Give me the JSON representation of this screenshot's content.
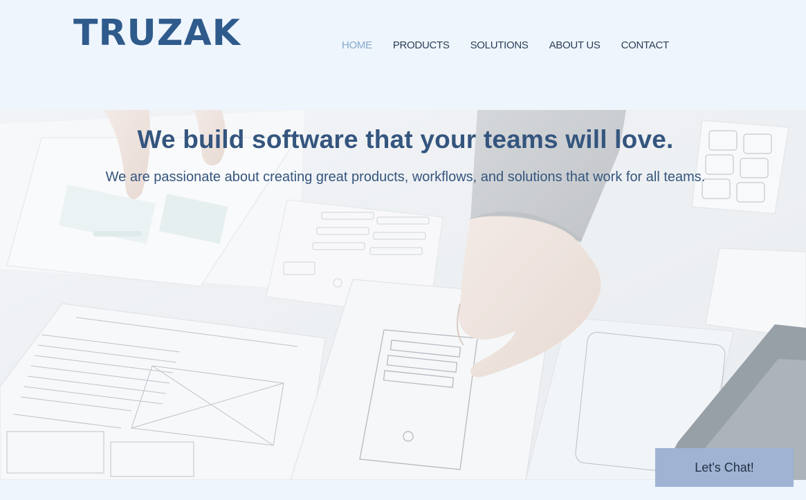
{
  "brand": {
    "logo_text": "TRUZAK"
  },
  "nav": {
    "items": [
      {
        "label": "HOME",
        "active": true
      },
      {
        "label": "PRODUCTS",
        "active": false
      },
      {
        "label": "SOLUTIONS",
        "active": false
      },
      {
        "label": "ABOUT US",
        "active": false
      },
      {
        "label": "CONTACT",
        "active": false
      }
    ]
  },
  "hero": {
    "title": "We build software that your teams will love.",
    "subtitle": "We are passionate about creating great products, workflows, and solutions that work for all teams.",
    "image_subject": "hands-arranging-wireframe-sketches"
  },
  "chat": {
    "label": "Let's Chat!"
  },
  "colors": {
    "page_bg": "#eef5fd",
    "brand_blue": "#2f5a8c",
    "nav_text": "#2b3e56",
    "nav_active": "#86a8cc",
    "hero_text": "#34557e",
    "chat_bg": "#9fb3d2"
  }
}
